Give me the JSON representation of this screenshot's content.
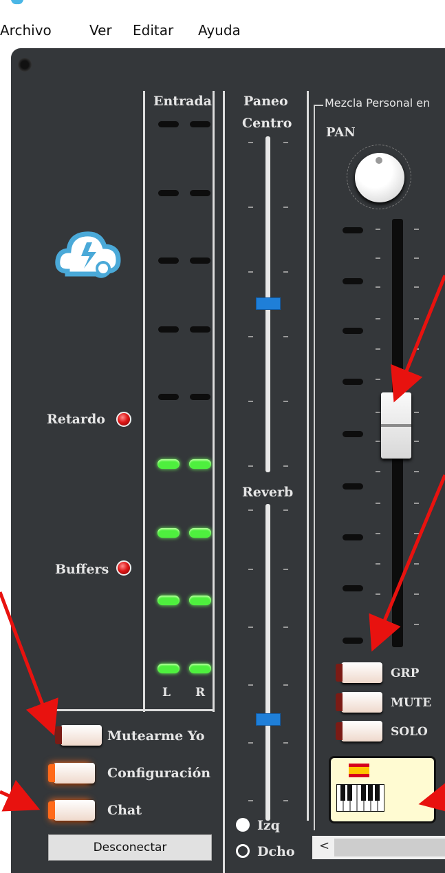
{
  "menu": {
    "items": [
      "Archivo",
      "Ver",
      "Editar",
      "Ayuda"
    ]
  },
  "meters": {
    "title": "Entrada",
    "left": "L",
    "right": "R"
  },
  "status": {
    "delay_label": "Retardo",
    "buffers_label": "Buffers"
  },
  "pan": {
    "title": "Paneo",
    "value": "Centro"
  },
  "reverb": {
    "title": "Reverb",
    "channel_left": "Izq",
    "channel_right": "Dcho",
    "selected": "Dcho"
  },
  "mix": {
    "group_title": "Mezcla Personal en",
    "pan_label": "PAN",
    "grp": "GRP",
    "mute": "MUTE",
    "solo": "SOLO",
    "instrument_icon": "keyboard-icon",
    "flag_icon": "spain-flag-icon"
  },
  "buttons": {
    "mute_self": "Mutearme Yo",
    "settings": "Configuración",
    "chat": "Chat",
    "disconnect": "Desconectar"
  },
  "scrollbar": {
    "left_arrow": "<"
  },
  "colors": {
    "panel": "#34373a",
    "led_on": "#4ef03e",
    "slider_thumb": "#1f7fd8",
    "annotation": "#e8120f"
  }
}
